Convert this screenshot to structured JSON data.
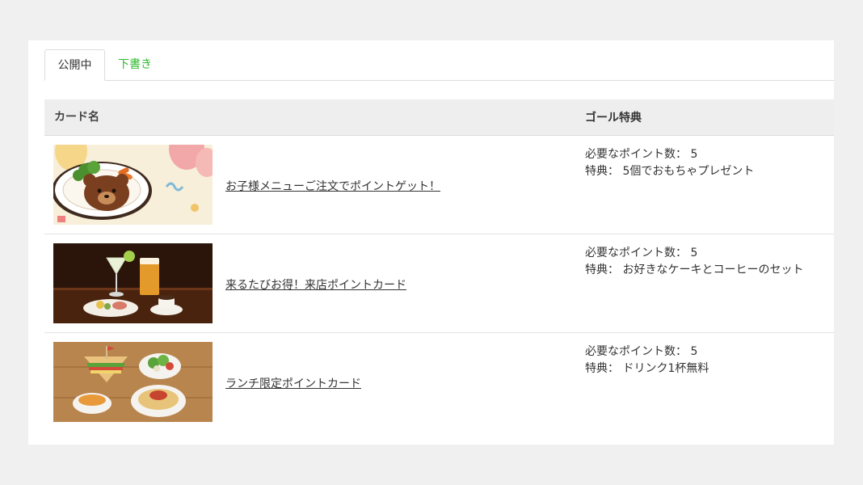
{
  "tabs": [
    {
      "label": "公開中",
      "active": true
    },
    {
      "label": "下書き",
      "active": false
    }
  ],
  "table": {
    "headers": {
      "card_name": "カード名",
      "reward": "ゴール特典"
    },
    "points_label": "必要なポイント数：",
    "benefit_label": "特典：",
    "rows": [
      {
        "name": "お子様メニューご注文でポイントゲット！",
        "points": "5",
        "benefit": "5個でおもちゃプレゼント",
        "image": "kids-meal-bear-image"
      },
      {
        "name": "来るたびお得！来店ポイントカード",
        "points": "5",
        "benefit": "お好きなケーキとコーヒーのセット",
        "image": "bar-drinks-image"
      },
      {
        "name": "ランチ限定ポイントカード",
        "points": "5",
        "benefit": "ドリンク1杯無料",
        "image": "lunch-set-image"
      }
    ]
  },
  "colors": {
    "background": "#f0f0f0",
    "panel": "#ffffff",
    "draft_tab": "#2db82d",
    "header_bg": "#eeeeee"
  }
}
